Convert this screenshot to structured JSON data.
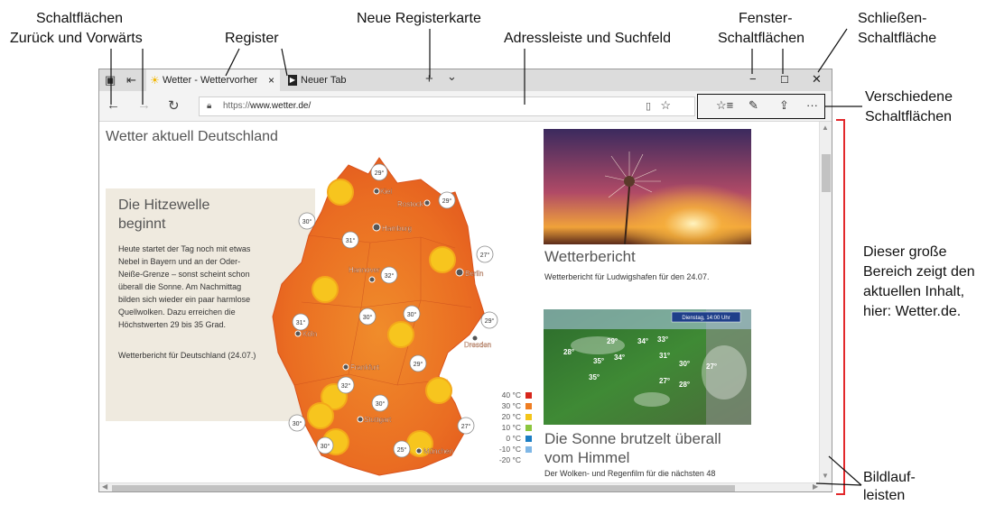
{
  "annotations": {
    "back_forward_line1": "Schaltflächen",
    "back_forward_line2": "Zurück und Vorwärts",
    "register": "Register",
    "new_tab": "Neue Registerkarte",
    "address": "Adressleiste und Suchfeld",
    "window_buttons_line1": "Fenster-",
    "window_buttons_line2": "Schaltflächen",
    "close_line1": "Schließen-",
    "close_line2": "Schaltfläche",
    "various_line1": "Verschiedene",
    "various_line2": "Schaltflächen",
    "content_line1": "Dieser große",
    "content_line2": "Bereich zeigt den",
    "content_line3": "aktuellen Inhalt,",
    "content_line4": "hier: Wetter.de.",
    "scrollbars_line1": "Bildlauf-",
    "scrollbars_line2": "leisten"
  },
  "colors": {
    "accent_red": "#e2282b"
  },
  "browser": {
    "tabs": [
      {
        "label": "Wetter - Wettervorhersage",
        "icon": "sun-icon",
        "close": "×"
      },
      {
        "label": "Neuer Tab",
        "icon": "page-icon"
      }
    ],
    "new_tab_symbol": "+",
    "tab_menu_symbol": "⌄",
    "window": {
      "minimize": "−",
      "maximize": "☐",
      "close": "✕"
    },
    "nav": {
      "back": "←",
      "forward": "→",
      "refresh": "↻"
    },
    "address": {
      "prefix": "https://",
      "host": "www.wetter.de/"
    },
    "toolbar": {
      "favorites": "☆≡",
      "notes": "✎",
      "share": "⇪",
      "more": "···"
    }
  },
  "page": {
    "title": "Wetter aktuell Deutschland",
    "news": {
      "headline": "Die Hitzewelle beginnt",
      "body": "Heute startet der Tag noch mit etwas Nebel in Bayern und an der Oder-Neiße-Grenze – sonst scheint schon überall die Sonne. Am Nachmittag bilden sich wieder ein paar harmlose Quellwolken. Dazu erreichen die Höchstwerten 29 bis 35 Grad.",
      "link": "Wetterbericht für Deutschland (24.07.)"
    },
    "map": {
      "cities": [
        "Kiel",
        "Rostock",
        "Hamburg",
        "Berlin",
        "Hannover",
        "Köln",
        "Frankfurt",
        "Dresden",
        "Stuttgart",
        "München"
      ],
      "temps": [
        "29°",
        "29°",
        "30°",
        "27°",
        "31°",
        "32°",
        "30°",
        "31°",
        "30°",
        "29°",
        "29°",
        "32°",
        "30°",
        "30°",
        "27°",
        "30°",
        "25°"
      ]
    },
    "legend": [
      {
        "label": "40 °C",
        "color": "#d7261b"
      },
      {
        "label": "30 °C",
        "color": "#ef7d22"
      },
      {
        "label": "20 °C",
        "color": "#f3c51a"
      },
      {
        "label": "10 °C",
        "color": "#8cc63f"
      },
      {
        "label": "0 °C",
        "color": "#1c7ec4"
      },
      {
        "label": "-10 °C",
        "color": "#7fb7e6"
      },
      {
        "label": "-20 °C",
        "color": "#c7ddf2"
      }
    ],
    "card1": {
      "title": "Wetterbericht",
      "subtitle": "Wetterbericht für Ludwigshafen für den 24.07."
    },
    "card2": {
      "title": "Die Sonne brutzelt überall vom Himmel",
      "subtitle": "Der Wolken- und Regenfilm für die nächsten 48",
      "badge": "Dienstag, 14:00 Uhr",
      "temps": [
        "29°",
        "34°",
        "33°",
        "28°",
        "35°",
        "34°",
        "31°",
        "30°",
        "27°",
        "35°",
        "27°",
        "28°"
      ]
    }
  }
}
